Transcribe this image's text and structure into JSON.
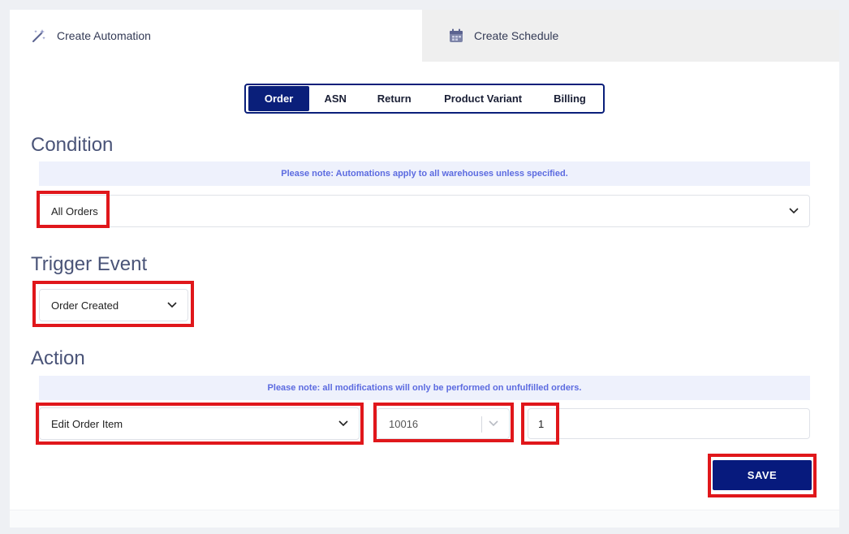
{
  "tabs": [
    {
      "label": "Create Automation",
      "icon": "magic-wand-icon",
      "active": true
    },
    {
      "label": "Create Schedule",
      "icon": "calendar-icon",
      "active": false
    }
  ],
  "entity_types": {
    "options": [
      "Order",
      "ASN",
      "Return",
      "Product Variant",
      "Billing"
    ],
    "selected": "Order"
  },
  "condition": {
    "title": "Condition",
    "note": "Please note: Automations apply to all warehouses unless specified.",
    "select_value": "All Orders"
  },
  "trigger": {
    "title": "Trigger Event",
    "select_value": "Order Created"
  },
  "action": {
    "title": "Action",
    "note": "Please note: all modifications will only be performed on unfulfilled orders.",
    "action_value": "Edit Order Item",
    "item_value": "10016",
    "quantity_value": "1"
  },
  "save_label": "SAVE",
  "colors": {
    "brand": "#0a1f7a",
    "highlight": "#e0171b",
    "note_text": "#5c6be0",
    "note_bg": "#eef1fc"
  }
}
